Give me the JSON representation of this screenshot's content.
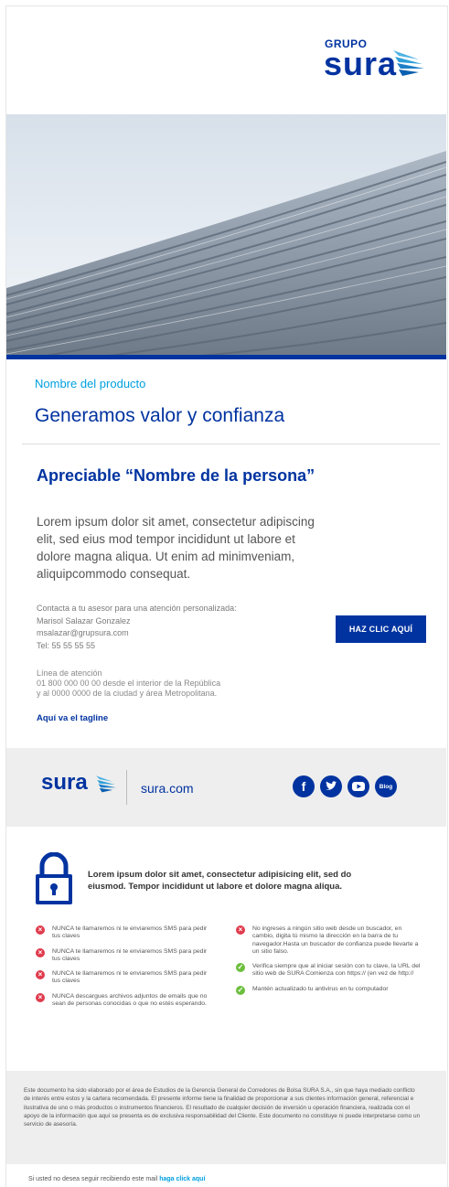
{
  "brand": {
    "grupo": "GRUPO",
    "name": "sura",
    "primary_color": "#0033a0",
    "accent_color": "#00a0df"
  },
  "hero": {
    "description_icon": "metal-roof-photo"
  },
  "intro": {
    "product": "Nombre del producto",
    "headline": "Generamos valor y confianza",
    "greeting": "Apreciable “Nombre de la persona”",
    "body": "Lorem ipsum dolor sit amet, consectetur adipiscing elit, sed eius mod tempor incididunt ut labore et dolore magna aliqua. Ut enim ad minimveniam, aliquipcommodo consequat."
  },
  "contact": {
    "intro": "Contacta a tu asesor para una atención personalizada:",
    "name": "Marisol Salazar Gonzalez",
    "email": "msalazar@grupsura.com",
    "phone": "Tel: 55 55 55 55",
    "cta_label": "HAZ CLIC AQUÍ"
  },
  "attention": {
    "title": "Línea de atención",
    "line1": "01 800 000 00 00 desde el interior de la República",
    "line2": "y al 0000 0000 de la ciudad y área Metropolitana."
  },
  "tagline": "Aquí va el tagline",
  "footer_social": {
    "logo": "sura",
    "site": "sura.com",
    "icons": [
      "facebook-icon",
      "twitter-icon",
      "youtube-icon",
      "blog-icon"
    ],
    "blog_label": "Blog"
  },
  "security": {
    "heading": "Lorem ipsum dolor sit amet, consectetur adipisicing elit, sed do eiusmod. Tempor incididunt ut labore et dolore magna aliqua.",
    "left": [
      "NUNCA te llamaremos ni te enviaremos SMS para pedir tus claves",
      "NUNCA te llamaremos ni te enviaremos SMS para pedir tus claves",
      "NUNCA te llamaremos ni te enviaremos SMS para pedir tus claves",
      "NUNCA descargues archivos adjuntos de emails que no sean de personas conocidas o que no estés esperando."
    ],
    "right": [
      "No ingreses a ningún sitio web desde un buscador, en cambio, digita tú mismo la dirección en la barra de tu navegador.Hasta un buscador de confianza puede llevarte a un sitio falso.",
      "Verifica siempre que al iniciar sesión con tu clave, la URL del sitio web de SURA Comienza con https:// (en vez de http://",
      "Mantén actualizado tu antivirus en tu computador"
    ]
  },
  "disclaimer": "Este documento ha sido elaborado por el área de Estudios de la Gerencia General de Corredores de Bolsa SURA S.A., sin que haya mediado conflicto de interés entre estos y la cartera recomendada. El presente informe tiene la finalidad de proporcionar a sus clientes información general, referencial e ilustrativa de uno o más productos o instrumentos financieros. El resultado de cualquier decisión de inversión u operación financiera, realizada con el apoyo de la información que aquí se presenta es de exclusiva responsabilidad del Cliente. Este documento no constituye ni puede interpretarse como un servicio de asesoría.",
  "unsubscribe": {
    "text": "Si usted no desea seguir recibiendo este mail",
    "link": "haga click aquí"
  }
}
